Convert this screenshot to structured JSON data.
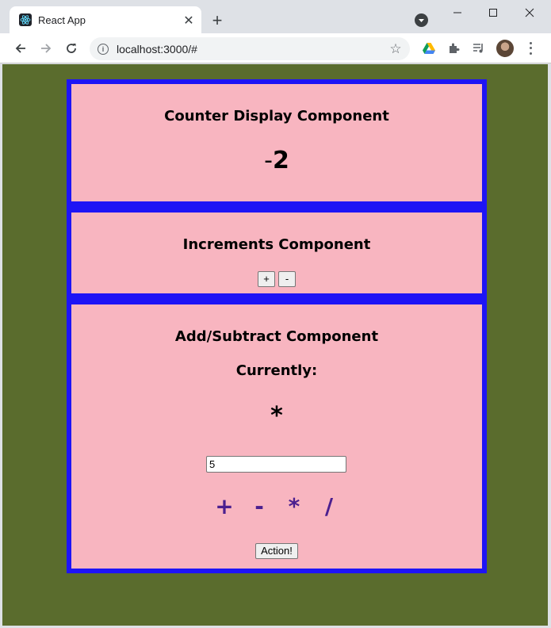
{
  "browser": {
    "tab_title": "React App",
    "tab_close": "✕",
    "new_tab": "+",
    "url": "localhost:3000/#"
  },
  "counter_display": {
    "title": "Counter Display Component",
    "sign": "-",
    "value": "2"
  },
  "increments": {
    "title": "Increments Component",
    "plus_label": "+",
    "minus_label": "-"
  },
  "add_subtract": {
    "title": "Add/Subtract Component",
    "currently_label": "Currently:",
    "current_operator": "*",
    "input_value": "5",
    "operators": [
      "+",
      "-",
      "*",
      "/"
    ],
    "action_label": "Action!"
  },
  "colors": {
    "page_background": "#5a6c2d",
    "panel_background": "#f8b5c0",
    "panel_border": "#1e14f5",
    "operator_color": "#4b1f8f"
  }
}
